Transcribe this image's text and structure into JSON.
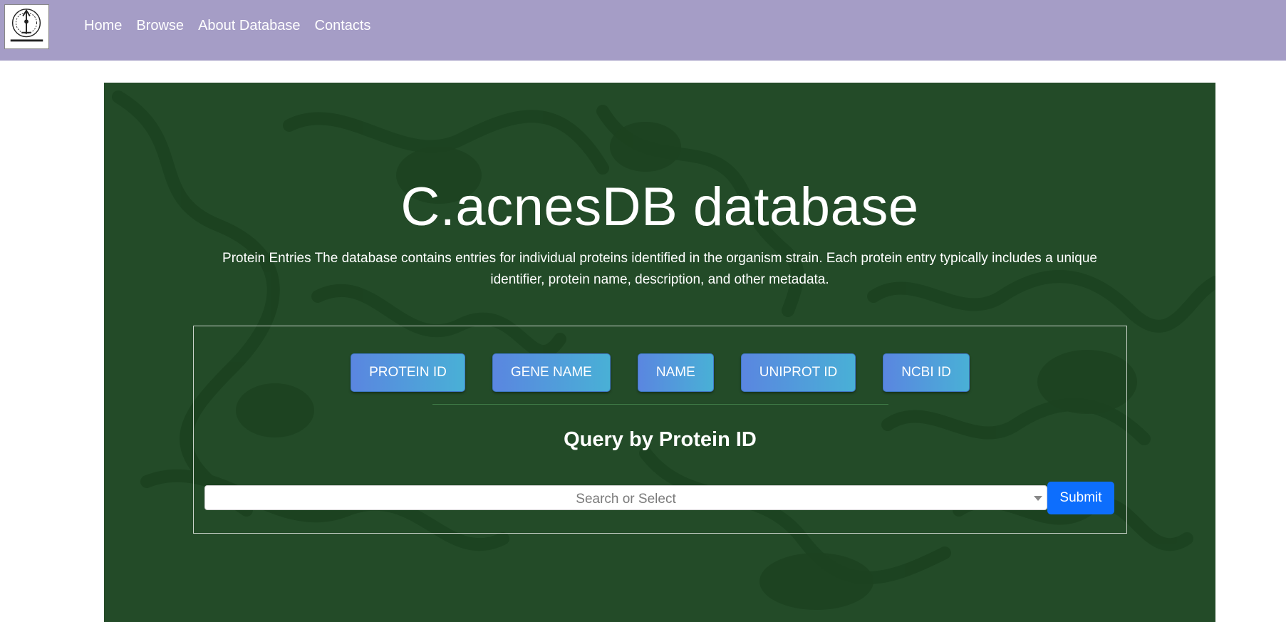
{
  "nav": {
    "logo_icon": "institute-emblem-logo",
    "links": [
      "Home",
      "Browse",
      "About Database",
      "Contacts"
    ]
  },
  "hero": {
    "title": "C.acnesDB database",
    "description": "Protein Entries The database contains entries for individual proteins identified in the organism strain. Each protein entry typically includes a unique identifier, protein name, description, and other metadata."
  },
  "query": {
    "tabs": [
      "PROTEIN ID",
      "GENE NAME",
      "NAME",
      "UNIPROT ID",
      "NCBI ID"
    ],
    "heading": "Query by Protein ID",
    "select_placeholder": "Search or Select",
    "submit_label": "Submit"
  },
  "colors": {
    "navbar": "#a59dc6",
    "hero_background": "#234b28",
    "submit_button": "#0d6efd"
  }
}
